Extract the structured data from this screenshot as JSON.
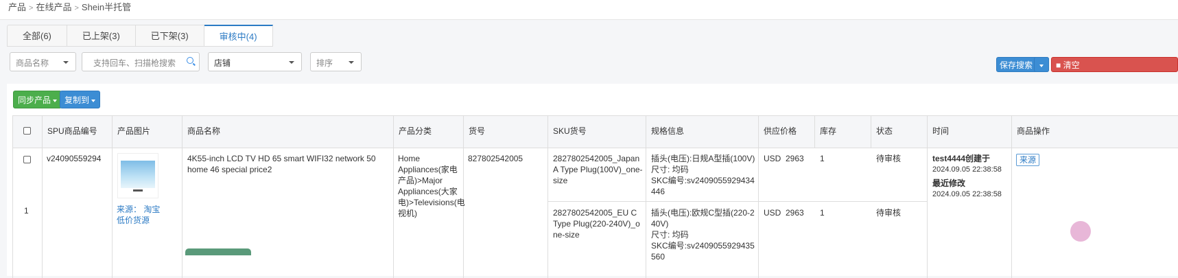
{
  "breadcrumb": [
    "产品",
    "在线产品",
    "Shein半托管"
  ],
  "tabs": [
    {
      "label": "全部(6)",
      "active": false
    },
    {
      "label": "已上架(3)",
      "active": false
    },
    {
      "label": "已下架(3)",
      "active": false
    },
    {
      "label": "审核中(4)",
      "active": true
    }
  ],
  "filters": {
    "product_name_select": "商品名称",
    "search_placeholder": "支持回车、扫描枪搜索",
    "shop_select": "店铺",
    "sort_select": "排序"
  },
  "toolbar": {
    "save_search": "保存搜索",
    "clear": "清空",
    "sync_products": "同步产品",
    "copy_to": "复制到"
  },
  "table": {
    "headers": [
      "SPU商品编号",
      "产品图片",
      "商品名称",
      "产品分类",
      "货号",
      "SKU货号",
      "规格信息",
      "供应价格",
      "库存",
      "状态",
      "时间",
      "商品操作"
    ],
    "rows": [
      {
        "index": "1",
        "spu": "v24090559294",
        "image_source_label": "来源：",
        "image_source_value": "淘宝",
        "image_source_extra": "低价货源",
        "name": "4K55-inch LCD TV HD 65 smart WIFI32 network 50 home 46 special price2",
        "category": "Home Appliances(家电产品)>Major Appliances(大家电)>Televisions(电视机)",
        "item_no": "827802542005",
        "skus": [
          {
            "sku": "2827802542005_Japan A Type Plug(100V)_one-size",
            "spec": [
              "插头(电压):日规A型插(100V)",
              "尺寸: 均码",
              "SKC编号:sv2409055929434446"
            ],
            "price": "USD  2963",
            "stock": "1",
            "status": "待审核"
          },
          {
            "sku": "2827802542005_EU C Type Plug(220-240V)_one-size",
            "spec": [
              "插头(电压):欧规C型插(220-240V)",
              "尺寸: 均码",
              "SKC编号:sv2409055929435560"
            ],
            "price": "USD  2963",
            "stock": "1",
            "status": "待审核"
          }
        ],
        "time": {
          "created_label": "test4444创建于",
          "created": "2024.09.05 22:38:58",
          "modified_label": "最近修改",
          "modified": "2024.09.05 22:38:58"
        },
        "action": "来源"
      }
    ]
  }
}
